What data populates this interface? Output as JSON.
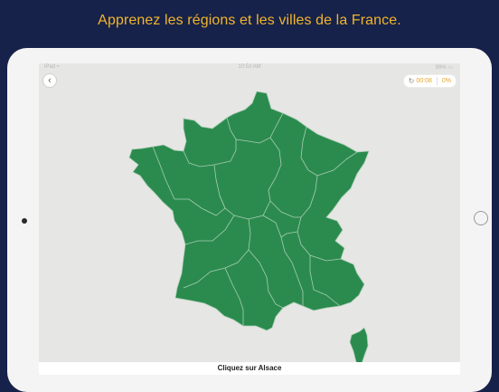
{
  "promo": {
    "headline": "Apprenez les régions et les villes de la France."
  },
  "status_bar": {
    "left": "iPad ≈",
    "time": "10:53 AM",
    "battery": "99% ▭"
  },
  "quiz": {
    "timer": "00:08",
    "score": "0%",
    "prompt": "Cliquez sur Alsace"
  },
  "colors": {
    "background": "#16224a",
    "promo_text": "#f2b52a",
    "map_fill": "#2b8b4e",
    "map_border": "#a8cdb3",
    "sea": "#e6e6e4"
  },
  "icons": {
    "back": "chevron-left-icon",
    "timer": "clock-refresh-icon"
  }
}
